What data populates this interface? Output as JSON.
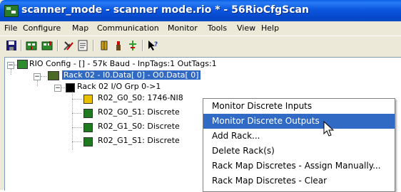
{
  "window": {
    "title": "scanner_mode - scanner mode.rio * - 56RioCfgScan"
  },
  "menubar": {
    "items": [
      "File",
      "Configure",
      "Map",
      "Communication",
      "Monitor",
      "Tools",
      "View",
      "Help"
    ]
  },
  "toolbar": {
    "icons": [
      "save-icon",
      "download-icon",
      "upload-icon",
      "tools-icon",
      "properties-icon",
      "input-icon",
      "output-icon",
      "add-icon",
      "help-pointer-icon"
    ]
  },
  "tree": {
    "root": {
      "label": "RIO Config - [] -  57k Baud - InpTags:1 OutTags:1",
      "expander": "−"
    },
    "rack": {
      "label": "Rack 02 - I0.Data[ 0] - O0.Da",
      "label_suffix": "ta[ 0]",
      "expander": "−"
    },
    "group": {
      "label": "Rack 02 I/O Grp 0->1",
      "expander": "−"
    },
    "slots": [
      {
        "label": "R02_G0_S0: 1746-NI8",
        "color": "#e8c000"
      },
      {
        "label": "R02_G0_S1: Discrete",
        "color": "#1f7a1f"
      },
      {
        "label": "R02_G1_S0: Discrete",
        "color": "#1f7a1f"
      },
      {
        "label": "R02_G1_S1: Discrete",
        "color": "#1f7a1f"
      }
    ]
  },
  "context_menu": {
    "items": [
      "Monitor Discrete Inputs",
      "Monitor Discrete Outputs",
      "Add Rack...",
      "Delete Rack(s)",
      "Rack Map Discretes - Assign Manually...",
      "Rack Map Discretes - Clear"
    ],
    "highlighted_index": 1
  },
  "colors": {
    "title_bar": "#0b57df",
    "selection": "#316ac5",
    "menu_bg": "#ece9d8"
  }
}
